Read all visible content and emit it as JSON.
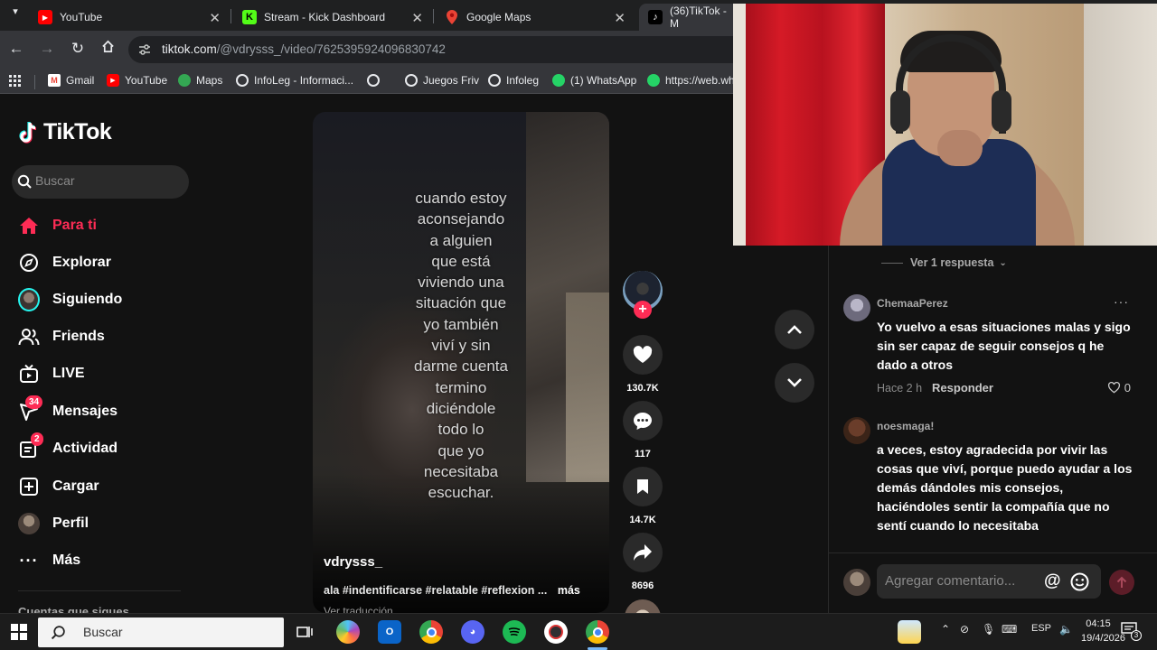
{
  "browser": {
    "tabs": [
      {
        "title": "YouTube",
        "icon": "youtube-icon",
        "active": false
      },
      {
        "title": "Stream - Kick Dashboard",
        "icon": "kick-icon",
        "active": false
      },
      {
        "title": "Google Maps",
        "icon": "google-maps-icon",
        "active": false
      },
      {
        "title": "(36)TikTok - M",
        "icon": "tiktok-icon",
        "active": true
      }
    ],
    "url_host": "tiktok.com",
    "url_path": "/@vdrysss_/video/7625395924096830742",
    "bookmarks": [
      {
        "label": "Gmail",
        "icon": "gmail-icon"
      },
      {
        "label": "YouTube",
        "icon": "youtube-icon"
      },
      {
        "label": "Maps",
        "icon": "google-maps-icon"
      },
      {
        "label": "InfoLeg - Informaci...",
        "icon": "globe-icon"
      },
      {
        "label": "",
        "icon": "globe-icon"
      },
      {
        "label": "Juegos Friv",
        "icon": "globe-icon"
      },
      {
        "label": "Infoleg",
        "icon": "globe-icon"
      },
      {
        "label": "(1) WhatsApp",
        "icon": "whatsapp-icon"
      },
      {
        "label": "https://web.wh",
        "icon": "whatsapp-icon"
      }
    ]
  },
  "tiktok": {
    "logo_text": "TikTok",
    "search_placeholder": "Buscar",
    "nav": [
      {
        "label": "Para ti",
        "icon": "home-icon",
        "active": true
      },
      {
        "label": "Explorar",
        "icon": "compass-icon"
      },
      {
        "label": "Siguiendo",
        "icon": "following-avatar-icon"
      },
      {
        "label": "Friends",
        "icon": "friends-icon"
      },
      {
        "label": "LIVE",
        "icon": "live-icon"
      },
      {
        "label": "Mensajes",
        "icon": "messages-icon",
        "badge": "34"
      },
      {
        "label": "Actividad",
        "icon": "activity-icon",
        "badge": "2"
      },
      {
        "label": "Cargar",
        "icon": "upload-icon"
      },
      {
        "label": "Perfil",
        "icon": "profile-avatar-icon"
      },
      {
        "label": "Más",
        "icon": "more-icon"
      }
    ],
    "following_header": "Cuentas que sigues",
    "video": {
      "caption_lines": [
        "cuando estoy",
        "aconsejando",
        "a alguien",
        "que está",
        "viviendo una",
        "situación que",
        "yo también",
        "viví y sin",
        "darme cuenta",
        "termino",
        "diciéndole",
        "todo lo",
        "que yo",
        "necesitaba",
        "escuchar."
      ],
      "author": "vdrysss_",
      "description": "ala #indentificarse #relatable #reflexion ...",
      "more": "más",
      "translation": "Ver traducción"
    },
    "actions": {
      "likes": "130.7K",
      "comments": "117",
      "saves": "14.7K",
      "shares": "8696"
    },
    "comments": {
      "view_replies": "Ver 1 respuesta",
      "items": [
        {
          "user": "ChemaaPerez",
          "text": "Yo vuelvo a esas situaciones malas y sigo sin ser capaz de seguir consejos q he dado a otros",
          "time": "Hace 2 h",
          "reply": "Responder",
          "likes": "0"
        },
        {
          "user": "noesmaga!",
          "text": "a veces, estoy agradecida por vivir las cosas que viví, porque puedo ayudar a los demás dándoles mis consejos, haciéndoles sentir la compañía que no sentí cuando lo necesitaba"
        }
      ],
      "add_placeholder": "Agregar comentario..."
    }
  },
  "taskbar": {
    "search_placeholder": "Buscar",
    "language": "ESP",
    "time": "04:15",
    "date": "19/4/2026",
    "notification_count": "3"
  },
  "colors": {
    "tiktok_red": "#fe2c55",
    "tiktok_cyan": "#25f4ee",
    "bg": "#121212"
  }
}
